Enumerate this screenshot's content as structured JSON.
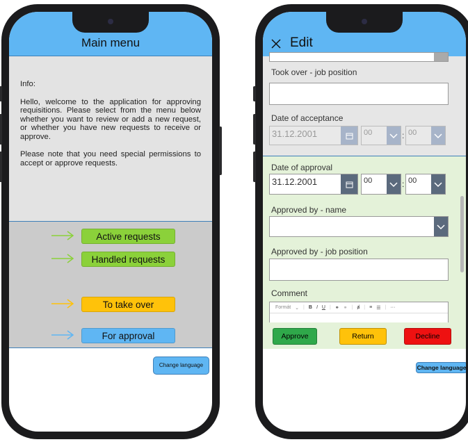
{
  "main_menu": {
    "title": "Main menu",
    "info_label": "Info:",
    "info_p1": "Hello, welcome to the application for approving requisitions. Please select from the menu below whether you want to review or add a new request, or whether you have new requests to receive or approve.",
    "info_p2": "Please note that you need special permissions to accept or approve requests.",
    "items": [
      {
        "label": "Active requests",
        "color": "#8bd13a"
      },
      {
        "label": "Handled requests",
        "color": "#8bd13a"
      },
      {
        "label": "To take over",
        "color": "#ffc20a"
      },
      {
        "label": "For approval",
        "color": "#5fb6f3"
      }
    ],
    "change_language": "Change language"
  },
  "edit": {
    "title": "Edit",
    "took_over_label": "Took over - job position",
    "took_over_value": "",
    "date_acceptance_label": "Date of acceptance",
    "date_acceptance": "31.12.2001",
    "acceptance_hour": "00",
    "acceptance_minute": "00",
    "date_approval_label": "Date of approval",
    "date_approval": "31.12.2001",
    "approval_hour": "00",
    "approval_minute": "00",
    "approved_by_name_label": "Approved by - name",
    "approved_by_name_value": "",
    "approved_by_job_label": "Approved by - job position",
    "approved_by_job_value": "",
    "comment_label": "Comment",
    "toolbar": {
      "format": "Formát",
      "bold": "B",
      "italic": "I",
      "underline": "U",
      "more": "···"
    },
    "buttons": {
      "approve": "Approve",
      "return": "Return",
      "decline": "Decline"
    },
    "button_colors": {
      "approve": "#2fa84a",
      "return": "#ffc20a",
      "decline": "#ee1111"
    },
    "change_language": "Change language"
  }
}
